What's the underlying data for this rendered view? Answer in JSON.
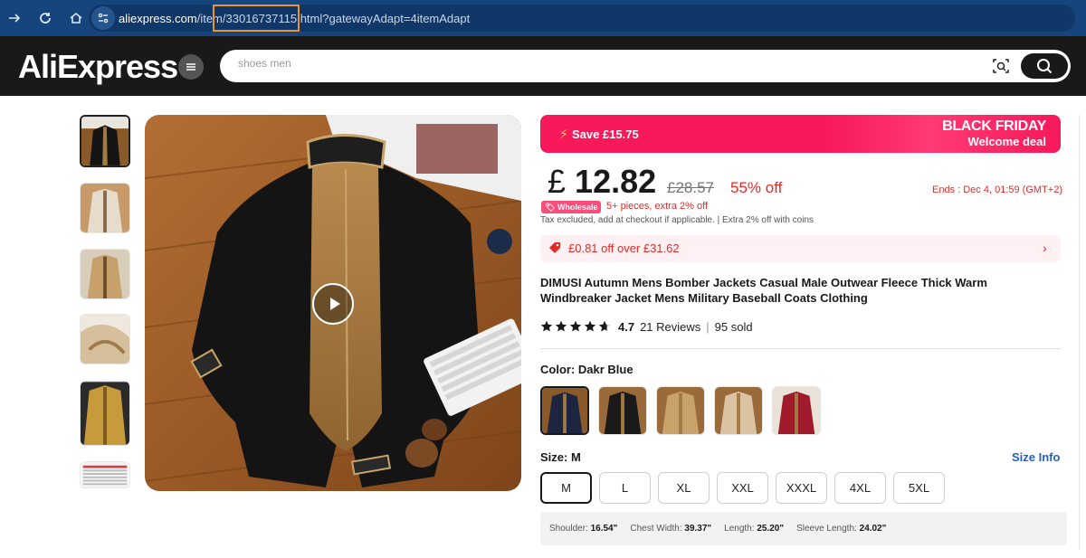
{
  "browser": {
    "url_host": "aliexpress.com",
    "url_path_pre": "/item/",
    "url_item_id": "33016737115",
    "url_path_post": ".html?gatewayAdapt=4itemAdapt"
  },
  "header": {
    "logo": "AliExpress",
    "search_placeholder": "shoes men"
  },
  "promo": {
    "save": "Save £15.75",
    "bf_line1": "BLACK FRIDAY",
    "bf_line2": "Welcome deal"
  },
  "price": {
    "currency": "£",
    "current": "12.82",
    "old": "£28.57",
    "discount": "55% off",
    "ends": "Ends :  Dec 4, 01:59 (GMT+2)"
  },
  "wholesale": {
    "badge": "Wholesale",
    "text": "5+ pieces, extra 2% off"
  },
  "tax_note": "Tax excluded, add at checkout if applicable.  |  Extra 2% off with coins",
  "coupon": {
    "text": "£0.81 off over £31.62"
  },
  "product": {
    "title": "DIMUSI Autumn Mens Bomber Jackets Casual Male Outwear Fleece Thick Warm Windbreaker Jacket Mens Military Baseball Coats Clothing",
    "rating": "4.7",
    "rating_value": 4.7,
    "reviews": "21 Reviews",
    "sold": "95 sold"
  },
  "color": {
    "label": "Color: Dakr Blue",
    "swatch_colors": [
      "#1d2540",
      "#1a1a1a",
      "#c9a26b",
      "#d9c3a3",
      "#a01a2b"
    ]
  },
  "size": {
    "label": "Size: M",
    "info": "Size Info",
    "options": [
      "M",
      "L",
      "XL",
      "XXL",
      "XXXL",
      "4XL",
      "5XL"
    ],
    "selected": "M"
  },
  "measurements": {
    "shoulder_label": "Shoulder:",
    "shoulder": "16.54\"",
    "chest_label": "Chest Width:",
    "chest": "39.37\"",
    "length_label": "Length:",
    "length": "25.20\"",
    "sleeve_label": "Sleeve Length:",
    "sleeve": "24.02\""
  },
  "colors": {
    "browser_bar": "#16457d",
    "header_bg": "#191919",
    "promo": "#f7195a",
    "accent_red": "#e02b27",
    "highlight_box": "#f0912a",
    "link_blue": "#1f5fc9"
  }
}
